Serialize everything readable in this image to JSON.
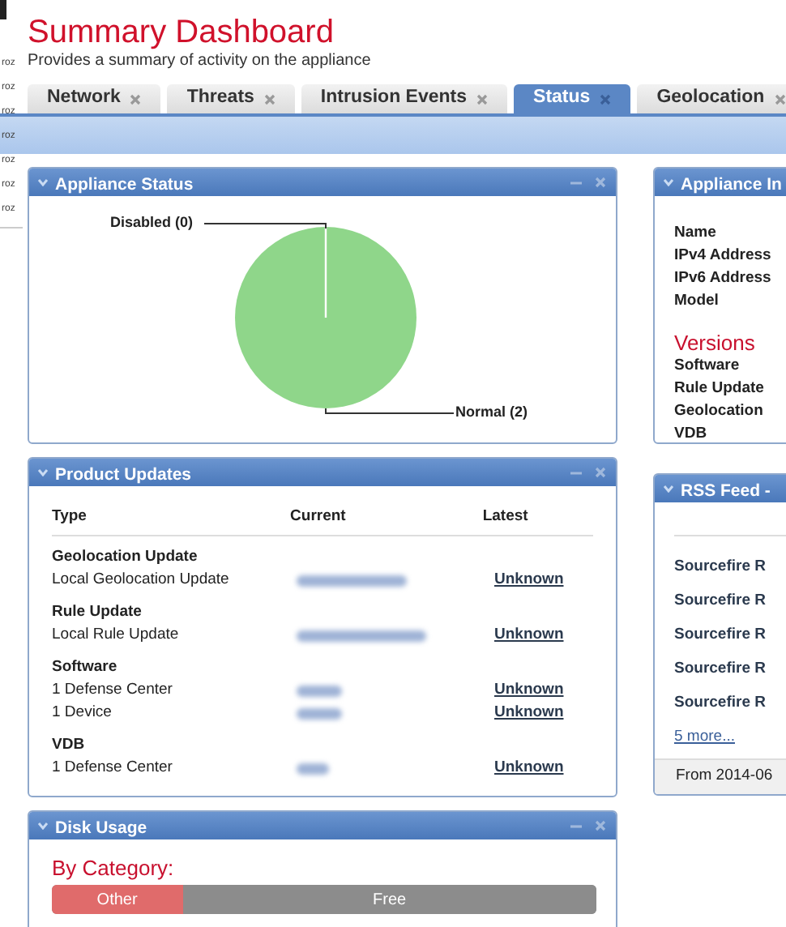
{
  "background_list": [
    "roz",
    "roz",
    "roz",
    "roz",
    "roz",
    "roz",
    "roz"
  ],
  "header": {
    "title": "Summary Dashboard",
    "subtitle": "Provides a summary of activity on the appliance"
  },
  "tabs": [
    {
      "label": "Network",
      "selected": false
    },
    {
      "label": "Threats",
      "selected": false
    },
    {
      "label": "Intrusion Events",
      "selected": false
    },
    {
      "label": "Status",
      "selected": true
    },
    {
      "label": "Geolocation",
      "selected": false
    }
  ],
  "appliance_status": {
    "title": "Appliance Status",
    "chart_data": {
      "type": "pie",
      "categories": [
        "Disabled (0)",
        "Normal (2)"
      ],
      "values": [
        0,
        2
      ]
    }
  },
  "product_updates": {
    "title": "Product Updates",
    "columns": [
      "Type",
      "Current",
      "Latest"
    ],
    "groups": [
      {
        "name": "Geolocation Update",
        "rows": [
          {
            "type": "Local Geolocation Update",
            "latest": "Unknown"
          }
        ]
      },
      {
        "name": "Rule Update",
        "rows": [
          {
            "type": "Local Rule Update",
            "latest": "Unknown"
          }
        ]
      },
      {
        "name": "Software",
        "rows": [
          {
            "type": "1 Defense Center",
            "latest": "Unknown"
          },
          {
            "type": "1 Device",
            "latest": "Unknown"
          }
        ]
      },
      {
        "name": "VDB",
        "rows": [
          {
            "type": "1 Defense Center",
            "latest": "Unknown"
          }
        ]
      }
    ]
  },
  "disk_usage": {
    "title": "Disk Usage",
    "heading": "By Category:",
    "segments": [
      {
        "label": "Other",
        "level": 0.24,
        "color": "#e06b6b"
      },
      {
        "label": "Free",
        "level": 0.76,
        "color": "#8c8c8c"
      }
    ]
  },
  "appliance_info": {
    "title": "Appliance In",
    "fields": [
      "Name",
      "IPv4 Address",
      "IPv6 Address",
      "Model"
    ],
    "versions_heading": "Versions",
    "versions": [
      "Software",
      "Rule Update",
      "Geolocation",
      "VDB"
    ]
  },
  "rss_feed": {
    "title": "RSS Feed -",
    "items": [
      "Sourcefire R",
      "Sourcefire R",
      "Sourcefire R",
      "Sourcefire R",
      "Sourcefire R"
    ],
    "more_link": "5 more...",
    "footer": "From 2014-06"
  }
}
